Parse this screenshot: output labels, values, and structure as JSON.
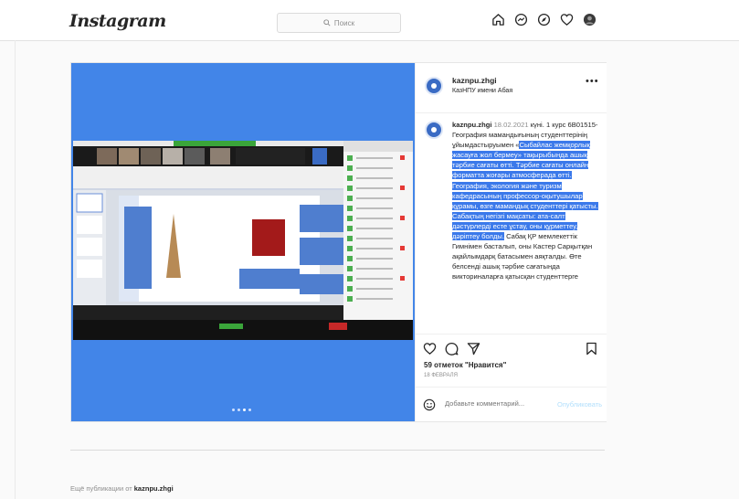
{
  "header": {
    "logo": "Instagram",
    "search_placeholder": "Поиск",
    "icons": [
      "home-icon",
      "messenger-icon",
      "explore-icon",
      "heart-icon",
      "profile-avatar"
    ]
  },
  "post": {
    "username": "kaznpu.zhgi",
    "location": "КазНПУ имени Абая",
    "caption_user": "kaznpu.zhgi",
    "caption_date": "18.02.2021",
    "caption_pre": "күні. 1 курс 6В01515-География мамандығының студенттерінің ұйымдастыруымен «",
    "caption_highlight": "Сыбайлас жемқорлық жасауға жол бермеу» тақырыбында ашық тәрбие сағаты өтті. Тәрбие сағаты онлайн форматта жоғары атмосферада өтті. География, экология және туризм кафедрасының профессор-оқытушылар құрамы, өзге мамандық студенттері қатысты. Сабақтың негізгі мақсаты: ата-салт дәстүрлерді есте ұстау, оны құрметтеу, дәріптеу болды.",
    "caption_post": " Сабақ ҚР мемлекеттік Гимнімен басталып, оны Кастер Сарқытқан ақайлымдарқ батасымен аяқталды. Өте белсенді ашық тәрбие сағатында викториналарға қатысқан студенттерге",
    "likes": "59 отметок \"Нравится\"",
    "time_ago": "18 ФЕВРАЛЯ",
    "comment_placeholder": "Добавьте комментарий...",
    "publish_label": "Опубликовать",
    "carousel": {
      "count": 4,
      "active": 3
    }
  },
  "footer": {
    "more_prefix": "Ещё публикации от",
    "more_user": "kaznpu.zhgi"
  },
  "colors": {
    "media_bg": "#4285e8",
    "highlight": "#3b79ea",
    "publish": "#b2dffc"
  }
}
